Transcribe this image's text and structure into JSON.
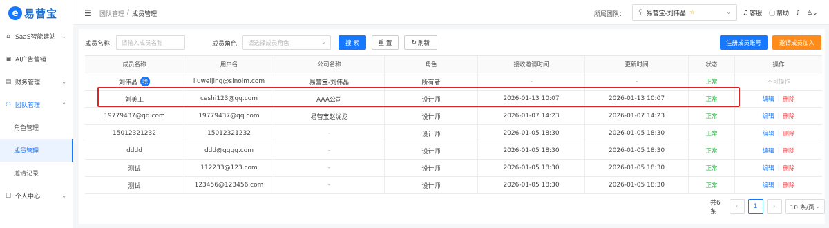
{
  "brand": {
    "logo_char": "e",
    "name": "易营宝"
  },
  "sidebar": {
    "items": [
      {
        "label": "SaaS智能建站",
        "icon": "home-icon",
        "has_chevron": true
      },
      {
        "label": "AI广告营销",
        "icon": "ad-icon",
        "has_chevron": false
      },
      {
        "label": "财务管理",
        "icon": "finance-icon",
        "has_chevron": true
      },
      {
        "label": "团队管理",
        "icon": "team-icon",
        "has_chevron": true,
        "expanded": true
      },
      {
        "label": "个人中心",
        "icon": "profile-icon",
        "has_chevron": true
      }
    ],
    "sub_items": [
      {
        "label": "角色管理"
      },
      {
        "label": "成员管理",
        "current": true
      },
      {
        "label": "邀请记录"
      }
    ]
  },
  "header": {
    "breadcrumb": [
      "团队管理",
      "/",
      "成员管理"
    ],
    "team_label": "所属团队：",
    "team_value": "易营宝-刘伟晶",
    "tools": {
      "service": "客服",
      "help": "帮助"
    }
  },
  "filters": {
    "member_name_label": "成员名称:",
    "member_name_placeholder": "请输入成员名称",
    "member_role_label": "成员角色:",
    "member_role_placeholder": "请选择成员角色",
    "search_btn": "搜 索",
    "reset_btn": "重 置",
    "refresh_btn": "刷新",
    "register_btn": "注册成员账号",
    "invite_btn": "邀请成员加入"
  },
  "table": {
    "columns": [
      "成员名称",
      "用户名",
      "公司名称",
      "角色",
      "接收邀请时间",
      "更新时间",
      "状态",
      "操作"
    ],
    "rows": [
      {
        "name": "刘伟晶",
        "me": "我",
        "username": "liuweijing@sinoim.com",
        "company": "易营宝-刘伟晶",
        "role": "所有者",
        "accepted": "-",
        "updated": "-",
        "status": "正常",
        "action": "不可操作"
      },
      {
        "name": "刘美工",
        "username": "ceshi123@qq.com",
        "company": "AAA公司",
        "role": "设计师",
        "accepted": "2026-01-13 10:07",
        "updated": "2026-01-13 10:07",
        "status": "正常",
        "edit": "编辑",
        "del": "删除"
      },
      {
        "name": "19779437@qq.com",
        "username": "19779437@qq.com",
        "company": "易营宝赵泷龙",
        "role": "设计师",
        "accepted": "2026-01-07 14:23",
        "updated": "2026-01-07 14:23",
        "status": "正常",
        "edit": "编辑",
        "del": "删除"
      },
      {
        "name": "15012321232",
        "username": "15012321232",
        "company": "-",
        "role": "设计师",
        "accepted": "2026-01-05 18:30",
        "updated": "2026-01-05 18:30",
        "status": "正常",
        "edit": "编辑",
        "del": "删除"
      },
      {
        "name": "dddd",
        "username": "ddd@qqqq.com",
        "company": "-",
        "role": "设计师",
        "accepted": "2026-01-05 18:30",
        "updated": "2026-01-05 18:30",
        "status": "正常",
        "edit": "编辑",
        "del": "删除"
      },
      {
        "name": "测试",
        "username": "112233@123.com",
        "company": "-",
        "role": "设计师",
        "accepted": "2026-01-05 18:30",
        "updated": "2026-01-05 18:30",
        "status": "正常",
        "edit": "编辑",
        "del": "删除"
      },
      {
        "name": "测试",
        "username": "123456@123456.com",
        "company": "-",
        "role": "设计师",
        "accepted": "2026-01-05 18:30",
        "updated": "2026-01-05 18:30",
        "status": "正常",
        "edit": "编辑",
        "del": "删除"
      }
    ]
  },
  "pagination": {
    "total": "共6条",
    "current_page": "1",
    "page_size": "10 条/页"
  },
  "colors": {
    "primary": "#1677ff",
    "orange": "#ff8c1a",
    "success": "#2fb84b",
    "danger": "#ff4d4f",
    "highlight": "#e02424"
  }
}
